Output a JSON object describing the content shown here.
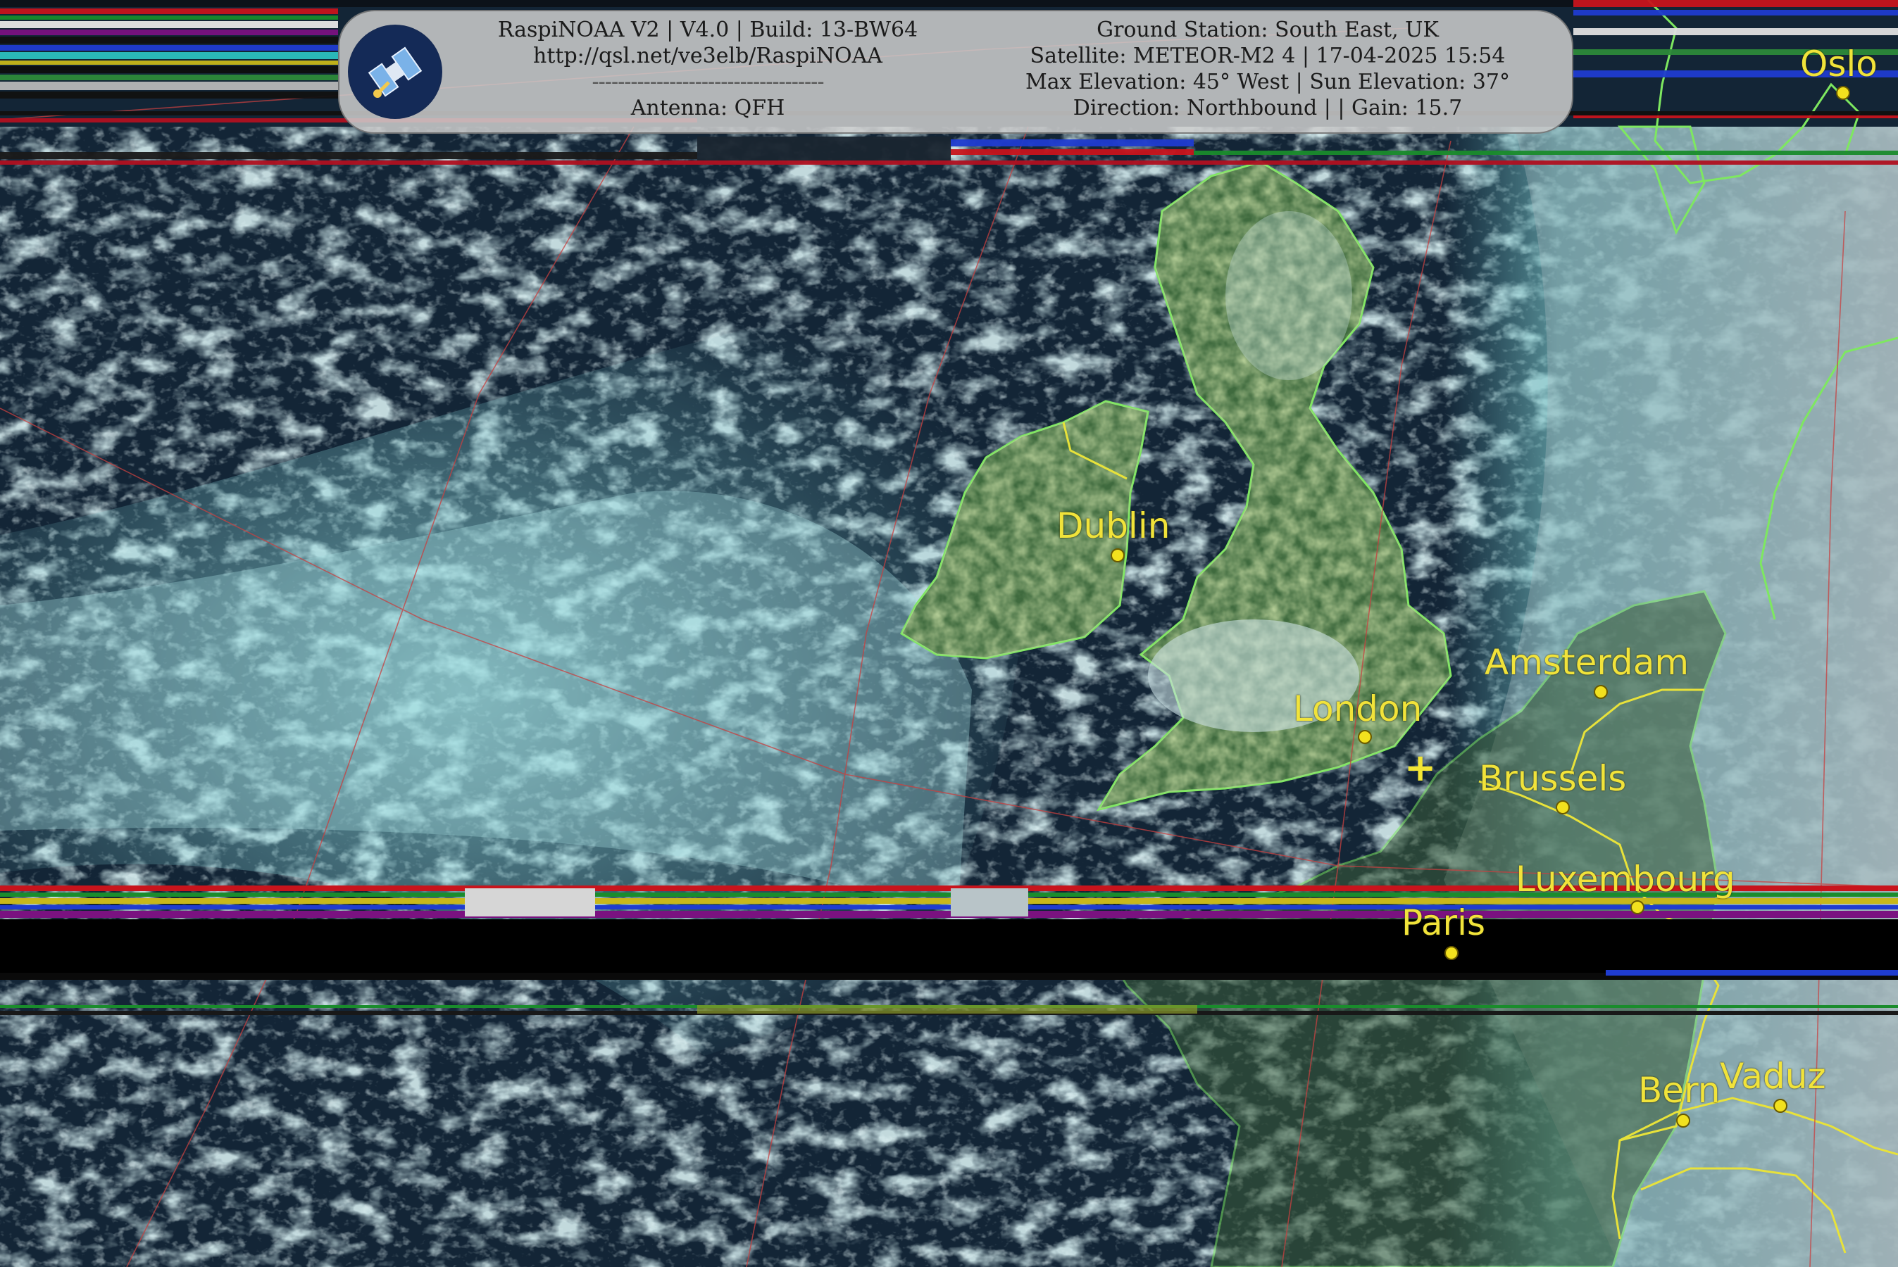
{
  "header": {
    "app_line": "RaspiNOAA V2 | V4.0 | Build: 13-BW64",
    "url_line": "http://qsl.net/ve3elb/RaspiNOAA",
    "divider": "------------------------------------",
    "antenna_line": "Antenna: QFH",
    "ground_station_line": "Ground Station: South East, UK",
    "satellite_line": "Satellite: METEOR-M2 4 | 17-04-2025 15:54",
    "elevation_line": "Max Elevation: 45° West | Sun Elevation: 37°",
    "direction_line": "Direction: Northbound | | Gain: 15.7"
  },
  "icons": {
    "logo": "satellite-logo-icon",
    "station": "plus-marker-icon"
  },
  "colors": {
    "coastline": "#7ee860",
    "border": "#e8e23a",
    "city": "#f2e11e",
    "label": "#f1e33a",
    "graticule": "#c84040",
    "ocean": "#0a1a2c",
    "cloud": "#8fe0e4"
  },
  "cities": [
    {
      "name": "Oslo"
    },
    {
      "name": "Dublin"
    },
    {
      "name": "Amsterdam"
    },
    {
      "name": "London"
    },
    {
      "name": "Brussels"
    },
    {
      "name": "Luxembourg"
    },
    {
      "name": "Paris"
    },
    {
      "name": "Bern"
    },
    {
      "name": "Vaduz"
    }
  ],
  "station_marker": "+"
}
